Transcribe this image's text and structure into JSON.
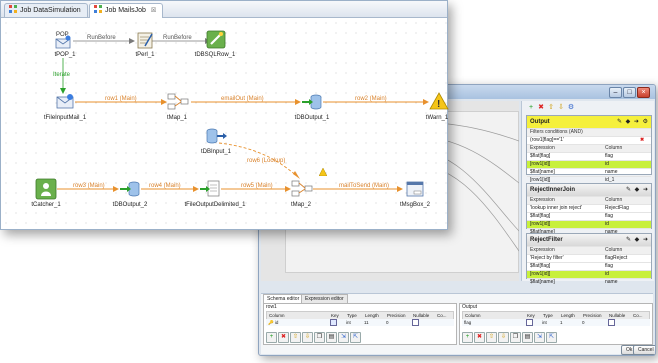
{
  "job_window": {
    "tabs": [
      {
        "label": "Job DataSimulation",
        "active": false
      },
      {
        "label": "Job MailsJob",
        "active": true,
        "close_glyph": "☒"
      }
    ]
  },
  "components": {
    "tpop": "tPOP_1",
    "tperl": "tPerl_1",
    "tdbsqlrow": "tDBSQLRow_1",
    "tfileinputmail": "tFileInputMail_1",
    "tmap1": "tMap_1",
    "tdboutput1": "tDBOutput_1",
    "twarn": "tWarn_1",
    "tdbinput": "tDBInput_1",
    "tcatcher": "tCatcher_1",
    "tdboutput2": "tDBOutput_2",
    "tfileoutputdelimited": "tFileOutputDelimited_1",
    "tmap2": "tMap_2",
    "tmsgbox": "tMsgBox_2",
    "pop_icon_text": "POP"
  },
  "links": {
    "runbefore1": "RunBefore",
    "runbefore2": "RunBefore",
    "iterate": "Iterate",
    "row1": "row1 (Main)",
    "emailout": "emailOut (Main)",
    "row2": "row2 (Main)",
    "row6": "row6 (Lookup)",
    "row3": "row3 (Main)",
    "row4": "row4 (Main)",
    "row5": "row5 (Main)",
    "mailtosend": "mailToSend (Main)"
  },
  "map_editor": {
    "output_panel": {
      "title": "Output",
      "filter_label": "Filters conditions (AND)",
      "filter_expr": "(row1[flag]=='1'",
      "headers": [
        "Expression",
        "Column"
      ],
      "rows": [
        {
          "expr": "$flat[flag]",
          "col": "flag",
          "highlight": false
        },
        {
          "expr": "[row1[id]]",
          "col": "id",
          "highlight": true
        },
        {
          "expr": "$flat[name]",
          "col": "name",
          "highlight": false
        },
        {
          "expr": "[row1[id]]",
          "col": "id_1",
          "highlight": false
        },
        {
          "expr": "[row1[name]]",
          "col": "name_1",
          "highlight": false
        }
      ]
    },
    "reject_inner_panel": {
      "title": "RejectInnerJoin",
      "headers": [
        "Expression",
        "Column"
      ],
      "rows": [
        {
          "expr": "'lookup inner join reject'",
          "col": "RejectFlag",
          "highlight": false
        },
        {
          "expr": "$flat[flag]",
          "col": "flag",
          "highlight": false
        },
        {
          "expr": "[row1[id]]",
          "col": "id",
          "highlight": true
        },
        {
          "expr": "$flat[name]",
          "col": "name",
          "highlight": false
        }
      ]
    },
    "reject_filter_panel": {
      "title": "RejectFilter",
      "headers": [
        "Expression",
        "Column"
      ],
      "rows": [
        {
          "expr": "'Reject by filter'",
          "col": "flagReject",
          "highlight": false
        },
        {
          "expr": "$flat[flag]",
          "col": "flag",
          "highlight": false
        },
        {
          "expr": "[row1[id]]",
          "col": "id",
          "highlight": true
        },
        {
          "expr": "$flat[name]",
          "col": "name",
          "highlight": false
        }
      ]
    },
    "schema_tabs": [
      "Schema editor",
      "Expression editor"
    ],
    "schema_left": {
      "label": "row1",
      "headers": [
        "Column",
        "Key",
        "Type",
        "Length",
        "Precision",
        "Nullable",
        "Co..."
      ],
      "row": [
        "id",
        "",
        "int",
        "11",
        "0",
        "",
        ""
      ]
    },
    "schema_right": {
      "label": "Output",
      "headers": [
        "Column",
        "Key",
        "Type",
        "Length",
        "Precision",
        "Nullable",
        "Co..."
      ],
      "row": [
        "flag",
        "",
        "int",
        "1",
        "0",
        "",
        ""
      ]
    },
    "buttons": {
      "ok": "Ok",
      "cancel": "Cancel"
    }
  },
  "colors": {
    "link_orange": "#e8912d",
    "link_gray": "#7a7a7a",
    "link_green": "#2aa02a",
    "header_yellow": "#f5f03c",
    "row_green": "#c8f03c"
  }
}
